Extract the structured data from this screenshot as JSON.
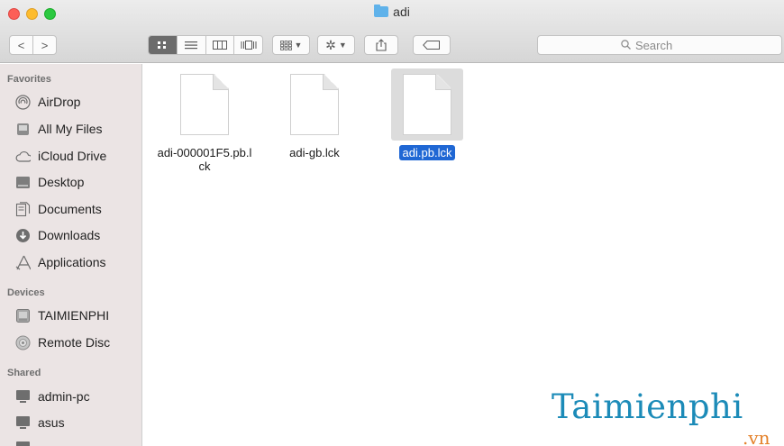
{
  "window": {
    "title": "adi"
  },
  "colors": {
    "selection": "#1f67d4",
    "sidebar_bg": "#ebe4e4",
    "folder_icon": "#5fb2ea",
    "watermark_main": "#1c8bb8",
    "watermark_sub": "#e4812a"
  },
  "toolbar": {
    "back_icon": "<",
    "forward_icon": ">",
    "view_modes": [
      "icon-view",
      "list-view",
      "column-view",
      "cover-flow-view"
    ],
    "active_view": "icon-view",
    "search_placeholder": "Search"
  },
  "sidebar": {
    "favorites_heading": "Favorites",
    "favorites": [
      {
        "label": "AirDrop",
        "icon": "airdrop-icon"
      },
      {
        "label": "All My Files",
        "icon": "all-my-files-icon"
      },
      {
        "label": "iCloud Drive",
        "icon": "cloud-icon"
      },
      {
        "label": "Desktop",
        "icon": "desktop-icon"
      },
      {
        "label": "Documents",
        "icon": "documents-icon"
      },
      {
        "label": "Downloads",
        "icon": "downloads-icon"
      },
      {
        "label": "Applications",
        "icon": "applications-icon"
      }
    ],
    "devices_heading": "Devices",
    "devices": [
      {
        "label": "TAIMIENPHI",
        "icon": "disk-icon"
      },
      {
        "label": "Remote Disc",
        "icon": "disc-icon"
      }
    ],
    "shared_heading": "Shared",
    "shared": [
      {
        "label": "admin-pc",
        "icon": "monitor-icon"
      },
      {
        "label": "asus",
        "icon": "monitor-icon"
      }
    ]
  },
  "files": [
    {
      "name": "adi-000001F5.pb.lck",
      "selected": false
    },
    {
      "name": "adi-gb.lck",
      "selected": false
    },
    {
      "name": "adi.pb.lck",
      "selected": true
    }
  ],
  "watermark": {
    "main": "Taimienphi",
    "sub": ".vn"
  }
}
